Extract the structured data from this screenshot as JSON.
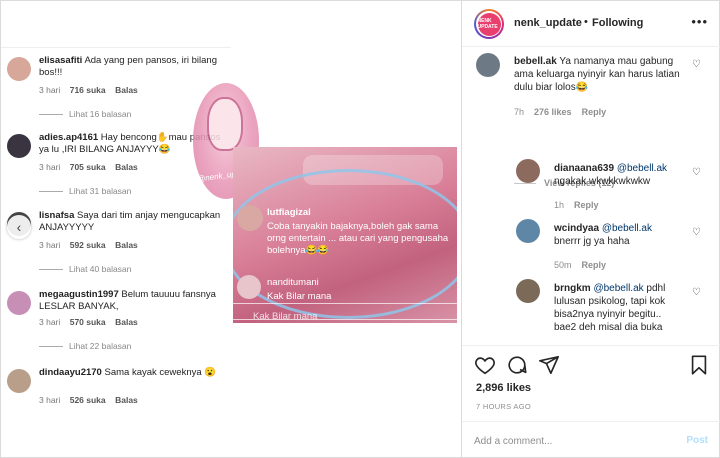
{
  "left_comments": [
    {
      "username": "elisasafiti",
      "text": "Ada yang pen pansos, iri bilang bos!!!",
      "time": "3 hari",
      "likes": "716 suka",
      "reply": "Balas",
      "replies": "Lihat 16 balasan",
      "avatar_color": "#d7a79a"
    },
    {
      "username": "adies.ap4161",
      "text": "Hay bencong✋mau pansos ya lu ,IRI BILANG ANJAYYY😂",
      "time": "3 hari",
      "likes": "705 suka",
      "reply": "Balas",
      "replies": "Lihat 31 balasan",
      "avatar_color": "#3a3340"
    },
    {
      "username": "lisnafsa",
      "text": "Saya dari tim anjay mengucapkan ANJAYYYYY",
      "time": "3 hari",
      "likes": "592 suka",
      "reply": "Balas",
      "replies": "Lihat 40 balasan",
      "avatar_color": "#4a4a4a"
    },
    {
      "username": "megaagustin1997",
      "text": "Belum tauuuu fansnya LESLAR BANYAK,",
      "time": "3 hari",
      "likes": "570 suka",
      "reply": "Balas",
      "replies": "Lihat 22 balasan",
      "avatar_color": "#c88fb6"
    },
    {
      "username": "dindaayu2170",
      "text": "Sama kayak ceweknya 😮",
      "time": "3 hari",
      "likes": "526 suka",
      "reply": "Balas",
      "replies": "",
      "avatar_color": "#b99e8a"
    }
  ],
  "watermark": {
    "text": "@nenk_update"
  },
  "pasted": {
    "username1": "lutfiagizal",
    "comment1": "Coba tanyakin bajaknya,boleh gak sama orng entertain ... atau cari yang pengusaha bolehnya😂😂",
    "username2": "nanditumani",
    "comment2": "Kak Bilar mana",
    "comment3": "Kak Bilar mana"
  },
  "header": {
    "username": "nenk_update",
    "separator": "•",
    "follow_status": "Following",
    "more": "•••",
    "avatar_text": "NENK UPDATE"
  },
  "right_comments": [
    {
      "username": "bebell.ak",
      "text": "Ya namanya mau gabung ama keluarga nyinyir kan harus latian dulu biar lolos😂",
      "time": "7h",
      "likes": "276 likes",
      "reply": "Reply",
      "avatar_color": "#6d7a86"
    },
    {
      "username": "dianaana639",
      "mention": "@bebell.ak",
      "text": "ngakak wkwkkwkwkw",
      "time": "1h",
      "reply": "Reply",
      "avatar_color": "#8d6a5e"
    },
    {
      "username": "wcindyaa",
      "mention": "@bebell.ak",
      "text": "bnerrr jg ya haha",
      "time": "50m",
      "reply": "Reply",
      "avatar_color": "#5e86a6"
    },
    {
      "username": "brngkm",
      "mention": "@bebell.ak",
      "text": "pdhl lulusan psikolog, tapi kok bisa2nya nyinyir begitu.. bae2 deh misal dia buka",
      "time": "",
      "reply": "",
      "avatar_color": "#7c6a58"
    }
  ],
  "view_replies": "View replies (12)",
  "actions": {
    "likes": "2,896 likes",
    "time": "7 HOURS AGO"
  },
  "add_comment": {
    "placeholder": "Add a comment...",
    "post": "Post"
  },
  "colors": {
    "accent_blue": "#0095f6",
    "post_disabled": "#b2dffc",
    "muted": "#8e8e8e"
  }
}
